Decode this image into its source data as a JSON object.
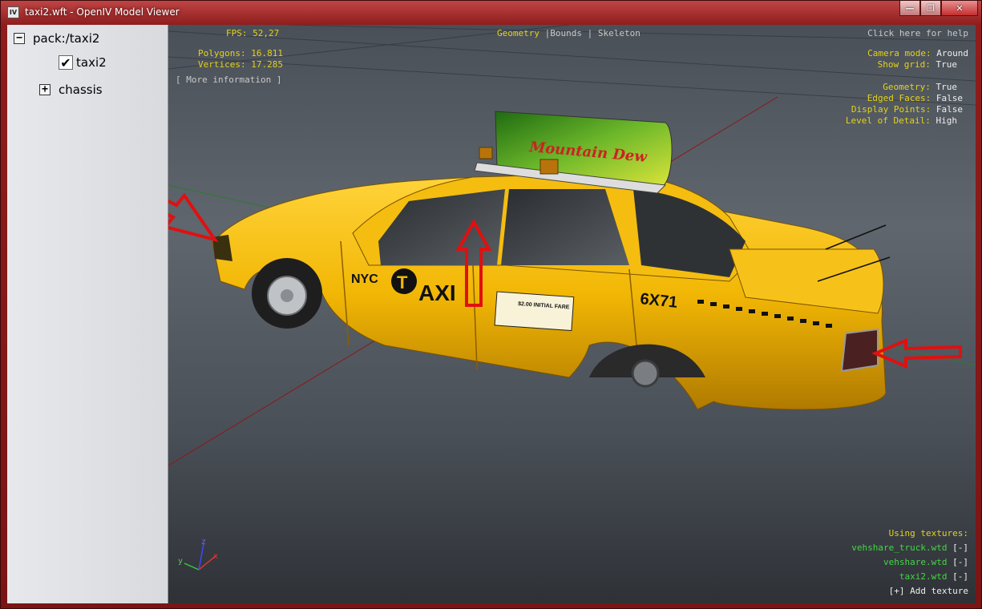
{
  "window": {
    "title": "taxi2.wft - OpenIV Model Viewer",
    "app_icon_label": "IV",
    "minimize_symbol": "—",
    "maximize_symbol": "❐",
    "close_symbol": "✕"
  },
  "tree": {
    "root_toggle": "−",
    "root_label": "pack:/taxi2",
    "item_check": "✔",
    "item_label": "taxi2",
    "chassis_toggle": "+",
    "chassis_label": "chassis"
  },
  "hud": {
    "fps_label": "FPS:",
    "fps_value": "52,27",
    "polygons_label": "Polygons:",
    "polygons_value": "16.811",
    "vertices_label": "Vertices:",
    "vertices_value": "17.285",
    "more_info": "[ More information ]",
    "modes": {
      "geometry": "Geometry",
      "sep1": "|",
      "bounds": "Bounds",
      "sep2": "|",
      "skeleton": "Skeleton"
    },
    "help": "Click here for help",
    "camera_mode_label": "Camera mode:",
    "camera_mode_value": "Around",
    "show_grid_label": "Show grid:",
    "show_grid_value": "True",
    "geometry_label": "Geometry:",
    "geometry_value": "True",
    "edged_faces_label": "Edged Faces:",
    "edged_faces_value": "False",
    "display_points_label": "Display Points:",
    "display_points_value": "False",
    "lod_label": "Level of Detail:",
    "lod_value": "High",
    "textures_title": "Using textures:",
    "textures": [
      {
        "name": "vehshare_truck.wtd",
        "remove": "[-]"
      },
      {
        "name": "vehshare.wtd",
        "remove": "[-]"
      },
      {
        "name": "taxi2.wtd",
        "remove": "[-]"
      }
    ],
    "add_texture": "[+] Add texture"
  },
  "axis": {
    "x": "x",
    "y": "y",
    "z": "z"
  },
  "car": {
    "brand_small": "NYC",
    "brand_t": "T",
    "brand_big": "AXI",
    "plate": "6X71",
    "fare": "$2.00 INITIAL FARE",
    "roof_ad": "Mountain Dew"
  },
  "colors": {
    "taxi_yellow": "#f2b705",
    "hud_yellow": "#e3d21c",
    "hud_green": "#44d644",
    "arrow_red": "#e01010"
  }
}
